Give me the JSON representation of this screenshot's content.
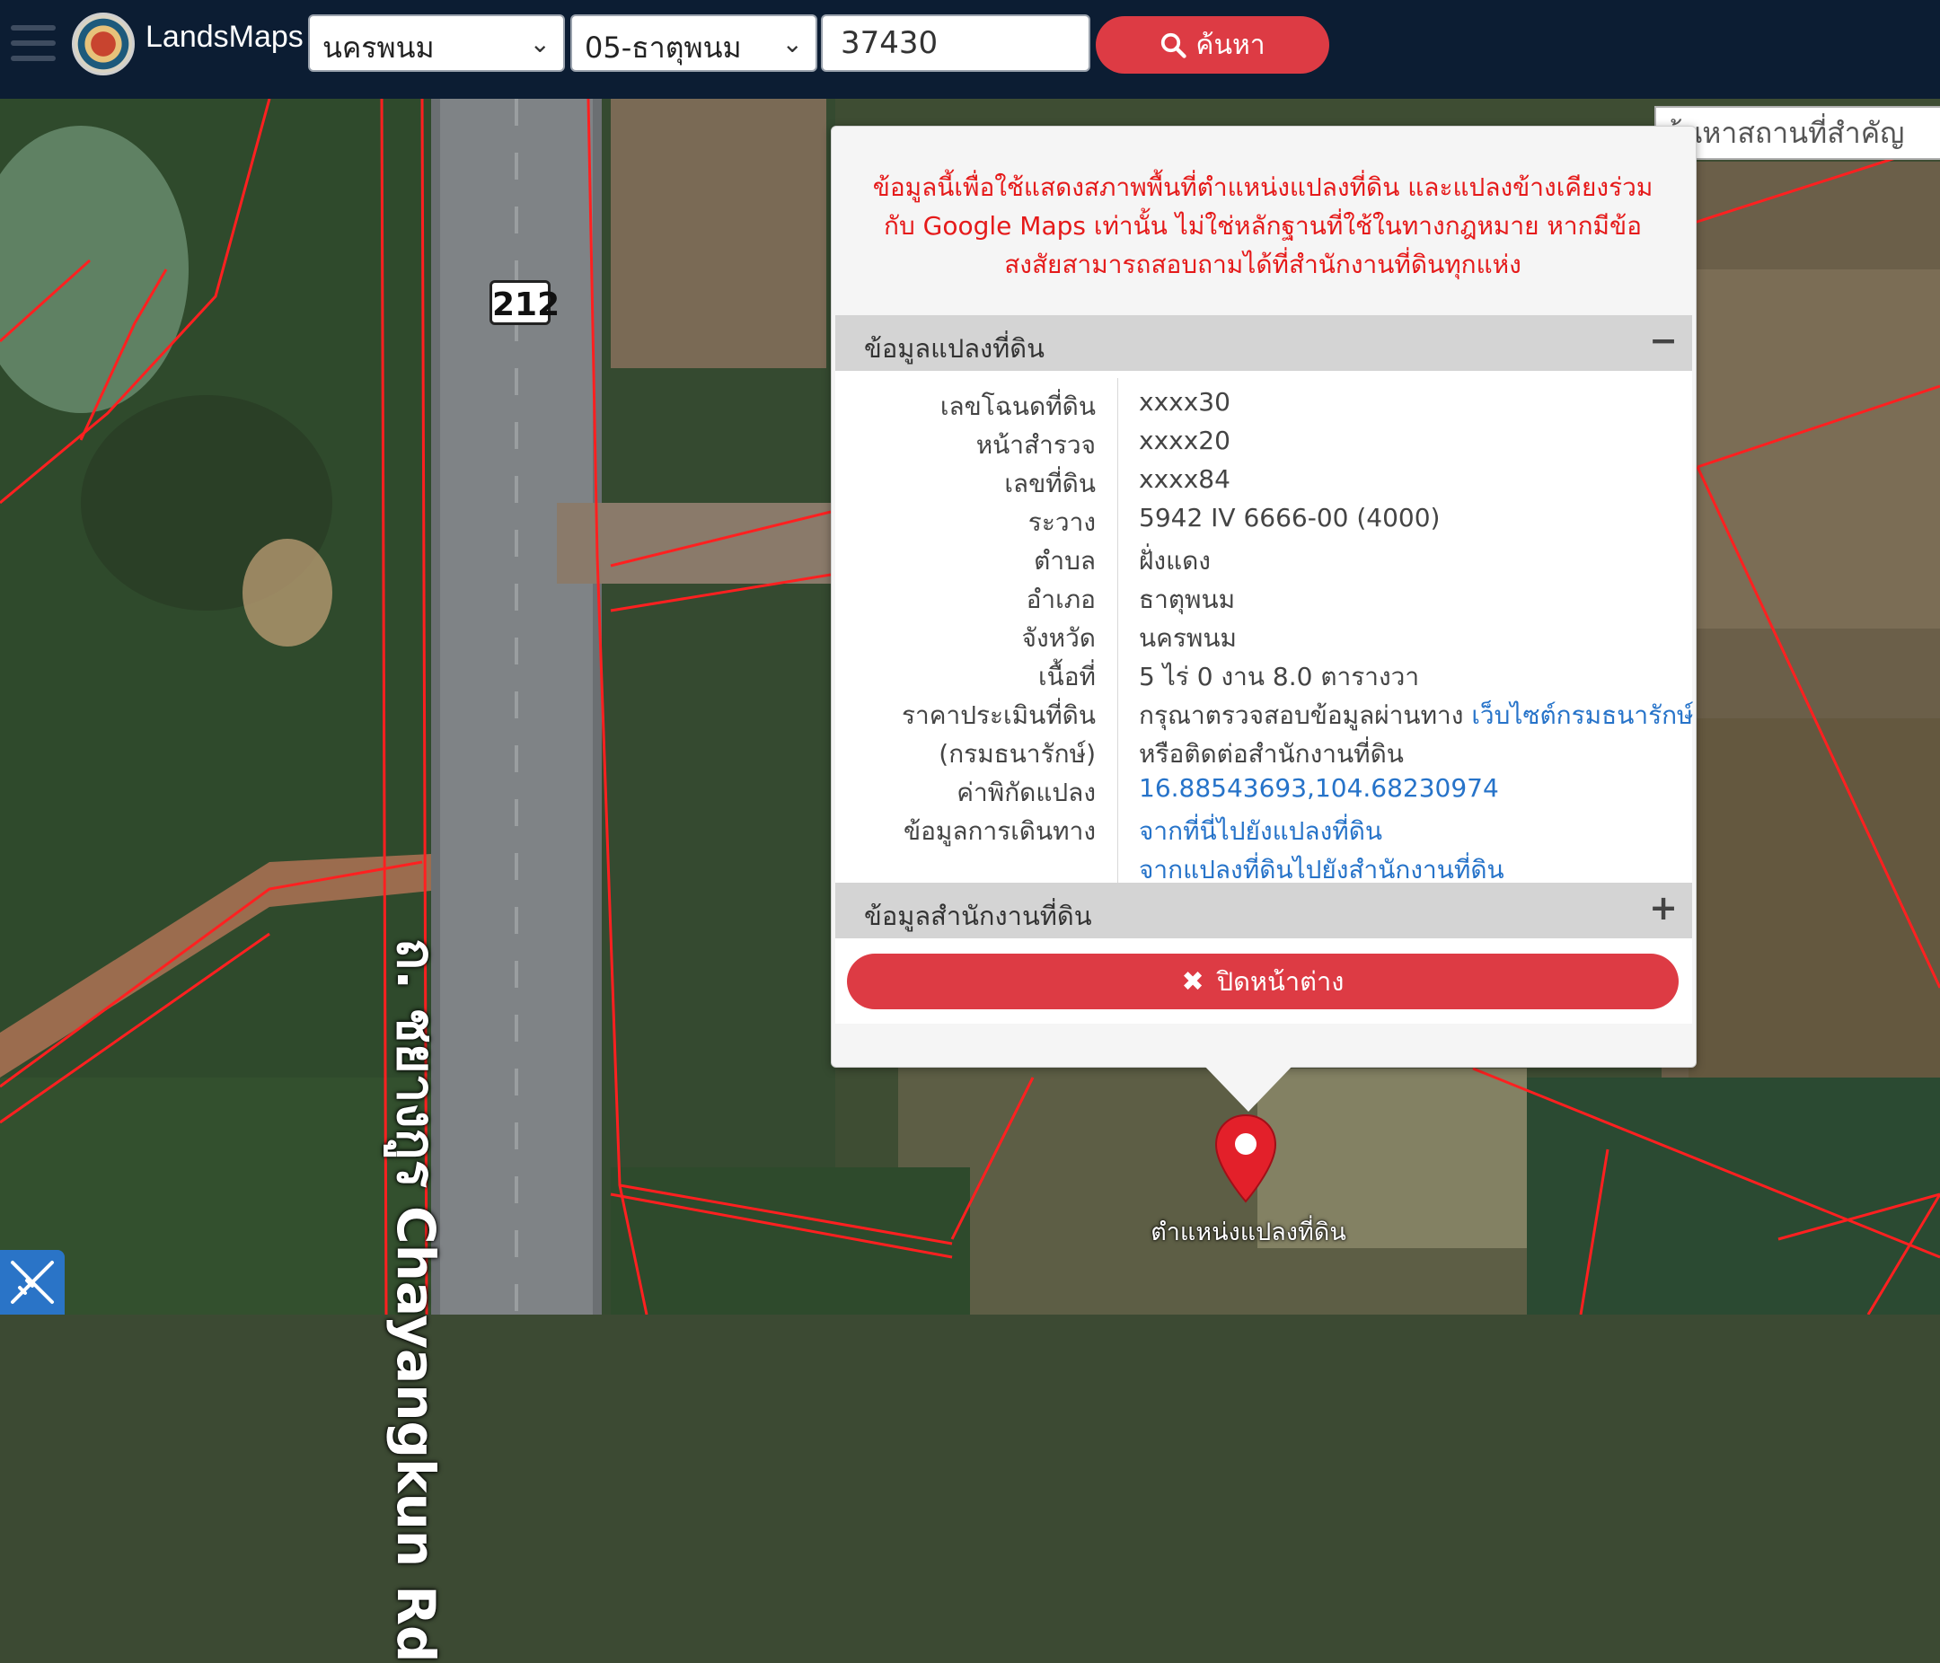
{
  "header": {
    "brand": "LandsMaps",
    "province": "นครพนม",
    "district": "05-ธาตุพนม",
    "deed_number": "37430",
    "search_label": "ค้นหา"
  },
  "landmark_search": {
    "placeholder": "ค้นหาสถานที่สำคัญ"
  },
  "popup": {
    "disclaimer": "ข้อมูลนี้เพื่อใช้แสดงสภาพพื้นที่ตำแหน่งแปลงที่ดิน และแปลงข้างเคียงร่วมกับ Google Maps เท่านั้น ไม่ใช่หลักฐานที่ใช้ในทางกฎหมาย หากมีข้อสงสัยสามารถสอบถามได้ที่สำนักงานที่ดินทุกแห่ง",
    "parcel_section_title": "ข้อมูลแปลงที่ดิน",
    "parcel_toggle": "−",
    "office_section_title": "ข้อมูลสำนักงานที่ดิน",
    "office_toggle": "+",
    "rows": {
      "deed_label": "เลขโฉนดที่ดิน",
      "deed_value": "xxxx30",
      "survey_label": "หน้าสำรวจ",
      "survey_value": "xxxx20",
      "land_no_label": "เลขที่ดิน",
      "land_no_value": "xxxx84",
      "sheet_label": "ระวาง",
      "sheet_value": "5942 IV 6666-00 (4000)",
      "subdistrict_label": "ตำบล",
      "subdistrict_value": "ฝั่งแดง",
      "district_label": "อำเภอ",
      "district_value": "ธาตุพนม",
      "province_label": "จังหวัด",
      "province_value": "นครพนม",
      "area_label": "เนื้อที่",
      "area_value": "5 ไร่ 0 งาน 8.0 ตารางวา",
      "price_label": "ราคาประเมินที่ดิน",
      "price_label2": "(กรมธนารักษ์)",
      "price_value": "กรุณาตรวจสอบข้อมูลผ่านทาง",
      "price_link": "เว็บไซต์กรมธนารักษ์",
      "price_value2": "หรือติดต่อสำนักงานที่ดิน",
      "coord_label": "ค่าพิกัดแปลง",
      "coord_value": "16.88543693,104.68230974",
      "travel_label": "ข้อมูลการเดินทาง",
      "travel_link1": "จากที่นี่ไปยังแปลงที่ดิน",
      "travel_link2": "จากแปลงที่ดินไปยังสำนักงานที่ดิน"
    },
    "close_label": "ปิดหน้าต่าง"
  },
  "map": {
    "marker_label": "ตำแหน่งแปลงที่ดิน",
    "road_label": "ถ. ชยางกูร Chayangkun Rd",
    "route_number": "212"
  },
  "colors": {
    "topbar": "#0c1d33",
    "accent_red": "#dd3b44",
    "disclaimer_red": "#e51a1a",
    "link_blue": "#2673c9",
    "parcel_line": "#ff2020"
  },
  "icons": {
    "menu": "hamburger-icon",
    "search": "search-icon",
    "close": "close-icon",
    "marker": "map-pin-icon",
    "measure": "ruler-pencil-icon"
  }
}
